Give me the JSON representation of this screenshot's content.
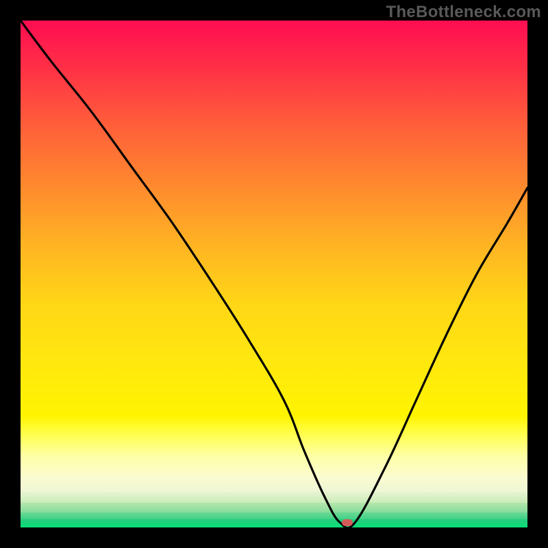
{
  "watermark": "TheBottleneck.com",
  "colors": {
    "frame": "#000000",
    "curve": "#000000",
    "marker": "#d45a5a",
    "watermark_text": "#595959"
  },
  "chart_data": {
    "type": "line",
    "title": "",
    "xlabel": "",
    "ylabel": "",
    "xlim": [
      0,
      100
    ],
    "ylim": [
      0,
      100
    ],
    "series": [
      {
        "name": "bottleneck-curve",
        "x": [
          0,
          6,
          14,
          22,
          30,
          38,
          45,
          52,
          56,
          60,
          63,
          66,
          72,
          78,
          84,
          90,
          96,
          100
        ],
        "values": [
          100,
          92,
          82,
          71,
          60,
          48,
          37,
          25,
          15,
          6,
          1,
          1,
          12,
          25,
          38,
          50,
          60,
          67
        ]
      }
    ],
    "marker": {
      "x": 64.5,
      "y": 1
    },
    "background_gradient": [
      {
        "stop": 0.0,
        "color": "#ff0e52"
      },
      {
        "stop": 0.2,
        "color": "#ff4d3d"
      },
      {
        "stop": 0.4,
        "color": "#ff922e"
      },
      {
        "stop": 0.55,
        "color": "#ffc220"
      },
      {
        "stop": 0.7,
        "color": "#ffe016"
      },
      {
        "stop": 0.8,
        "color": "#fff20f"
      },
      {
        "stop": 0.88,
        "color": "#fcfcb0"
      },
      {
        "stop": 0.92,
        "color": "#f3fad0"
      },
      {
        "stop": 0.96,
        "color": "#bfe8b0"
      },
      {
        "stop": 1.0,
        "color": "#0ee07a"
      }
    ]
  }
}
